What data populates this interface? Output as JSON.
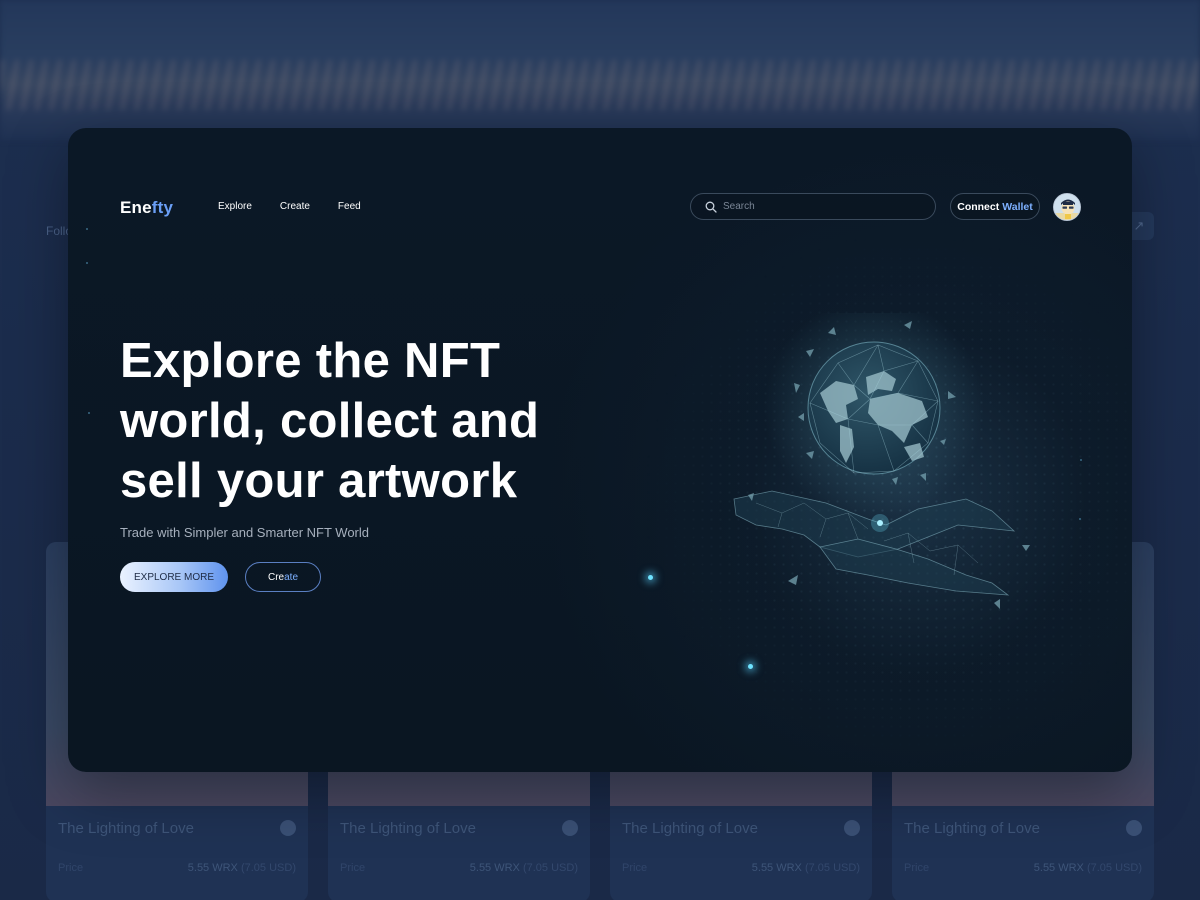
{
  "backdrop": {
    "follow_label": "Follo",
    "cards": [
      {
        "title": "The Lighting of Love",
        "price_label": "Price",
        "price": "5.55 WRX",
        "usd": "(7.05 USD)"
      },
      {
        "title": "The Lighting of Love",
        "price_label": "Price",
        "price": "5.55 WRX",
        "usd": "(7.05 USD)"
      },
      {
        "title": "The Lighting of Love",
        "price_label": "Price",
        "price": "5.55 WRX",
        "usd": "(7.05 USD)"
      },
      {
        "title": "The Lighting of Love",
        "price_label": "Price",
        "price": "5.55 WRX",
        "usd": "(7.05 USD)"
      }
    ]
  },
  "header": {
    "logo_part1": "Ene",
    "logo_part2": "fty",
    "nav": [
      "Explore",
      "Create",
      "Feed"
    ],
    "search_placeholder": "Search",
    "wallet_part1": "Connect",
    "wallet_part2": "Wallet"
  },
  "hero": {
    "title_lines": [
      "Explore the NFT",
      "world, collect and",
      "sell your artwork"
    ],
    "subtitle": "Trade with Simpler and Smarter NFT World",
    "explore_button": "EXPLORE MORE",
    "create_part1": "Cre",
    "create_part2": "ate"
  },
  "icons": {
    "search": "search-icon",
    "share": "share-icon",
    "avatar": "user-avatar",
    "illustration": "globe-in-hand-illustration"
  },
  "colors": {
    "accent": "#6a9ef5",
    "window_bg": "#0b1826",
    "backdrop_bg": "#1a2a47"
  }
}
